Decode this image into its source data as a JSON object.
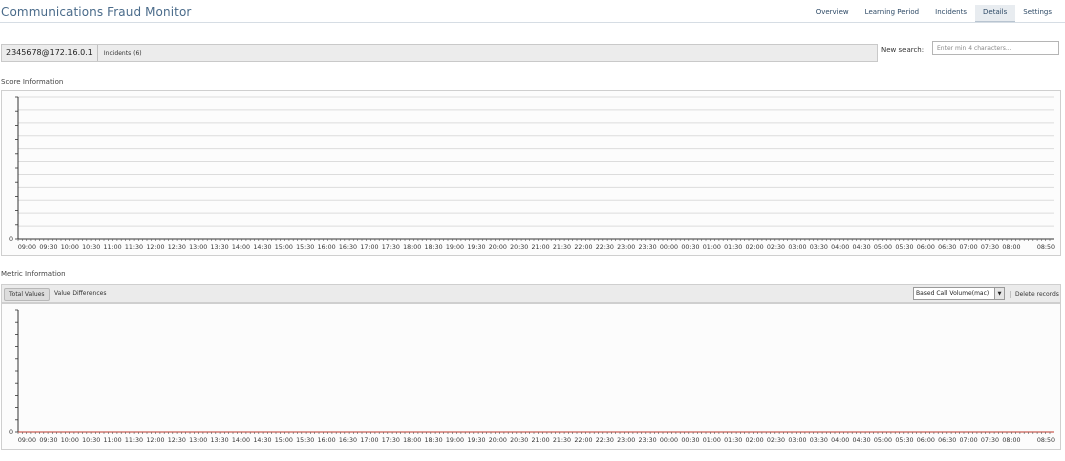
{
  "app": {
    "title": "Communications Fraud Monitor"
  },
  "nav": {
    "tabs": [
      {
        "label": "Overview",
        "active": false
      },
      {
        "label": "Learning Period",
        "active": false
      },
      {
        "label": "Incidents",
        "active": false
      },
      {
        "label": "Details",
        "active": true
      },
      {
        "label": "Settings",
        "active": false
      }
    ]
  },
  "entity": {
    "id": "2345678@172.16.0.1",
    "incidents_label": "Incidents (6)"
  },
  "search": {
    "label": "New search:",
    "placeholder": "Enter min 4 characters..."
  },
  "score_section": {
    "label": "Score Information"
  },
  "metric_section": {
    "label": "Metric Information",
    "total_values_label": "Total Values",
    "value_differences_label": "Value Differences",
    "metric_selected": "Based Call Volume(mac)",
    "delete_label": "Delete records"
  },
  "chart_data": [
    {
      "type": "line",
      "section": "Score Information",
      "y_tick_labels": [
        "0"
      ],
      "x_tick_labels": [
        "09:00",
        "09:30",
        "10:00",
        "10:30",
        "11:00",
        "11:30",
        "12:00",
        "12:30",
        "13:00",
        "13:30",
        "14:00",
        "14:30",
        "15:00",
        "15:30",
        "16:00",
        "16:30",
        "17:00",
        "17:30",
        "18:00",
        "18:30",
        "19:00",
        "19:30",
        "20:00",
        "20:30",
        "21:00",
        "21:30",
        "22:00",
        "22:30",
        "23:00",
        "23:30",
        "00:00",
        "00:30",
        "01:00",
        "01:30",
        "02:00",
        "02:30",
        "03:00",
        "03:30",
        "04:00",
        "04:30",
        "05:00",
        "05:30",
        "06:00",
        "06:30",
        "07:00",
        "07:30",
        "08:00",
        "08:50"
      ],
      "series": [],
      "grid": true
    },
    {
      "type": "line",
      "section": "Metric Information",
      "y_tick_labels": [
        "0"
      ],
      "x_tick_labels": [
        "09:00",
        "09:30",
        "10:00",
        "10:30",
        "11:00",
        "11:30",
        "12:00",
        "12:30",
        "13:00",
        "13:30",
        "14:00",
        "14:30",
        "15:00",
        "15:30",
        "16:00",
        "16:30",
        "17:00",
        "17:30",
        "18:00",
        "18:30",
        "19:00",
        "19:30",
        "20:00",
        "20:30",
        "21:00",
        "21:30",
        "22:00",
        "22:30",
        "23:00",
        "23:30",
        "00:00",
        "00:30",
        "01:00",
        "01:30",
        "02:00",
        "02:30",
        "03:00",
        "03:30",
        "04:00",
        "04:30",
        "05:00",
        "05:30",
        "06:00",
        "06:30",
        "07:00",
        "07:30",
        "08:00",
        "08:50"
      ],
      "series": [],
      "grid": false,
      "baseline_color": "#c0392b"
    }
  ]
}
